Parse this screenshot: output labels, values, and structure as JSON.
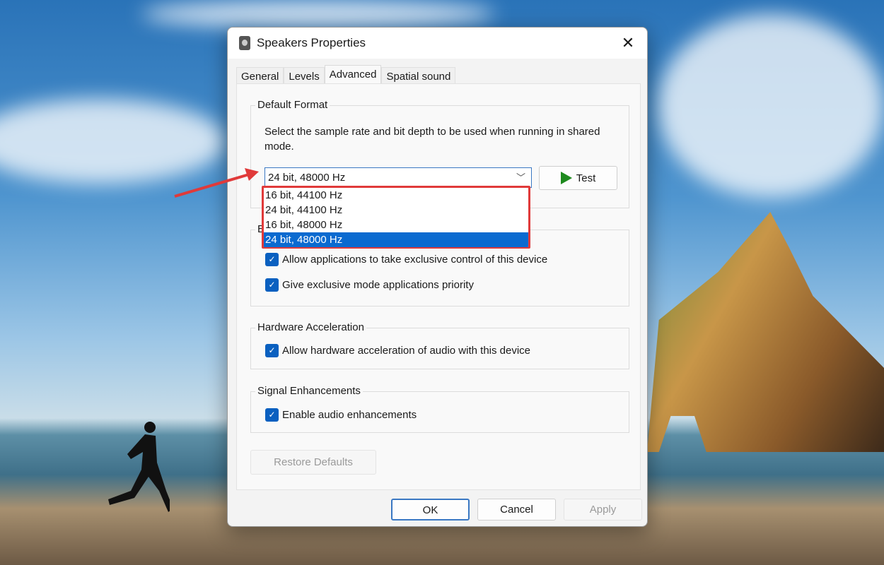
{
  "window": {
    "title": "Speakers Properties"
  },
  "tabs": [
    {
      "label": "General"
    },
    {
      "label": "Levels"
    },
    {
      "label": "Advanced"
    },
    {
      "label": "Spatial sound"
    }
  ],
  "default_format": {
    "label": "Default Format",
    "description": "Select the sample rate and bit depth to be used when running in shared mode.",
    "selected": "24 bit, 48000 Hz",
    "options": [
      "16 bit, 44100 Hz",
      "24 bit, 44100 Hz",
      "16 bit, 48000 Hz",
      "24 bit, 48000 Hz"
    ],
    "test_label": "Test"
  },
  "exclusive": {
    "label": "E",
    "items": [
      {
        "label": "Allow applications to take exclusive control of this device",
        "checked": true
      },
      {
        "label": "Give exclusive mode applications priority",
        "checked": true
      }
    ]
  },
  "hardware": {
    "label": "Hardware Acceleration",
    "item": {
      "label": "Allow hardware acceleration of audio with this device",
      "checked": true
    }
  },
  "signal": {
    "label": "Signal Enhancements",
    "item": {
      "label": "Enable audio enhancements",
      "checked": true
    }
  },
  "buttons": {
    "restore": "Restore Defaults",
    "ok": "OK",
    "cancel": "Cancel",
    "apply": "Apply"
  },
  "colors": {
    "accent": "#0a6ad0",
    "highlight": "#e03a3a"
  }
}
